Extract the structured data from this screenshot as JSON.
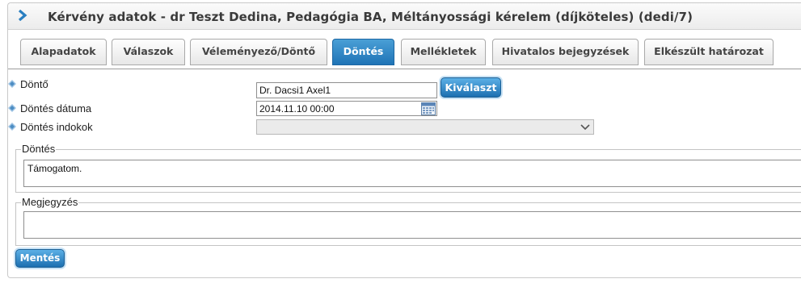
{
  "header": {
    "title": "Kérvény adatok - dr Teszt Dedina, Pedagógia BA, Méltányossági kérelem (díjköteles) (dedi/7)",
    "arrow_icon": "chevron-right-icon"
  },
  "tabs": [
    {
      "label": "Alapadatok",
      "active": false
    },
    {
      "label": "Válaszok",
      "active": false
    },
    {
      "label": "Véleményező/Döntő",
      "active": false
    },
    {
      "label": "Döntés",
      "active": true
    },
    {
      "label": "Mellékletek",
      "active": false
    },
    {
      "label": "Hivatalos bejegyzések",
      "active": false
    },
    {
      "label": "Elkészült határozat",
      "active": false
    }
  ],
  "form": {
    "dönto_label": "Döntő",
    "dönto_value": "Dr. Dacsi1 Axel1",
    "select_button": "Kiválaszt",
    "date_label": "Döntés dátuma",
    "date_value": "2014.11.10 00:00",
    "reasons_label": "Döntés indokok",
    "reasons_value": ""
  },
  "decision": {
    "legend": "Döntés",
    "text": "Támogatom."
  },
  "note": {
    "legend": "Megjegyzés",
    "text": ""
  },
  "actions": {
    "save_label": "Mentés"
  },
  "colors": {
    "accent": "#1f74b6",
    "accent_light": "#4a9fd6"
  }
}
